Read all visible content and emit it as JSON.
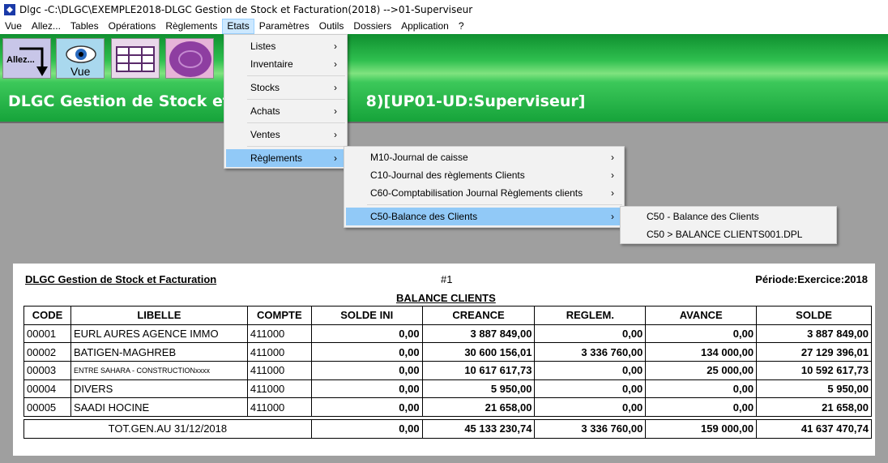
{
  "window": {
    "title": "Dlgc -C:\\DLGC\\EXEMPLE2018-DLGC Gestion de Stock et Facturation(2018) -->01-Superviseur"
  },
  "menubar": [
    "Vue",
    "Allez...",
    "Tables",
    "Opérations",
    "Règlements",
    "Etats",
    "Paramètres",
    "Outils",
    "Dossiers",
    "Application",
    "?"
  ],
  "toolbar": {
    "allez_label": "Allez...",
    "vue_label": "Vue"
  },
  "banner": {
    "left": "DLGC Gestion de Stock et F",
    "right": "8)[UP01-UD:Superviseur]"
  },
  "menu_etats": [
    "Listes",
    "Inventaire",
    "Stocks",
    "Achats",
    "Ventes",
    "Règlements"
  ],
  "menu_reglements": [
    "M10-Journal de caisse",
    "C10-Journal des règlements Clients",
    "C60-Comptabilisation Journal Règlements clients",
    "C50-Balance des Clients"
  ],
  "menu_balance": [
    "C50 - Balance des Clients",
    "C50 > BALANCE  CLIENTS001.DPL"
  ],
  "report": {
    "company": "DLGC Gestion de Stock et Facturation",
    "page": "#1",
    "period": "Période:Exercice:2018",
    "title": "BALANCE  CLIENTS",
    "columns": [
      "CODE",
      "LIBELLE",
      "COMPTE",
      "SOLDE INI",
      "CREANCE",
      "REGLEM.",
      "AVANCE",
      "SOLDE"
    ],
    "rows": [
      [
        "00001",
        "EURL AURES AGENCE IMMO",
        "411000",
        "0,00",
        "3 887 849,00",
        "0,00",
        "0,00",
        "3 887 849,00"
      ],
      [
        "00002",
        "BATIGEN-MAGHREB",
        "411000",
        "0,00",
        "30 600 156,01",
        "3 336 760,00",
        "134 000,00",
        "27 129 396,01"
      ],
      [
        "00003",
        "ENTRE SAHARA  - CONSTRUCTIONxxxx",
        "411000",
        "0,00",
        "10 617 617,73",
        "0,00",
        "25 000,00",
        "10 592 617,73"
      ],
      [
        "00004",
        "DIVERS",
        "411000",
        "0,00",
        "5 950,00",
        "0,00",
        "0,00",
        "5 950,00"
      ],
      [
        "00005",
        "SAADI HOCINE",
        "411000",
        "0,00",
        "21 658,00",
        "0,00",
        "0,00",
        "21 658,00"
      ]
    ],
    "total": {
      "label": "TOT.GEN.AU 31/12/2018",
      "values": [
        "0,00",
        "45 133 230,74",
        "3 336 760,00",
        "159 000,00",
        "41 637 470,74"
      ]
    }
  }
}
